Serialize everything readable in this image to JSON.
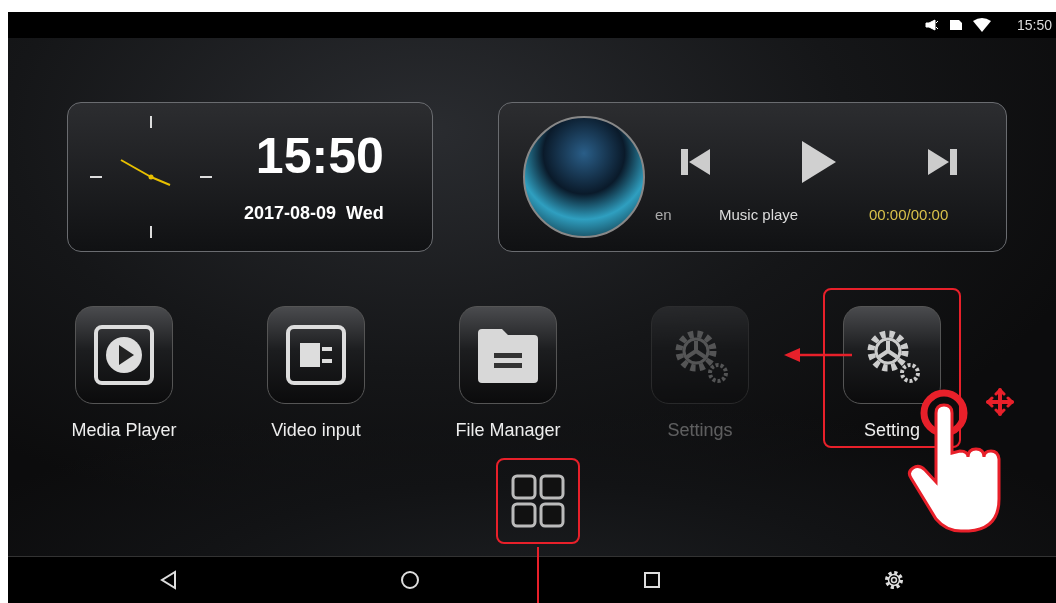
{
  "status_bar": {
    "time": "15:50"
  },
  "clock_widget": {
    "time": "15:50",
    "date": "2017-08-09",
    "weekday": "Wed"
  },
  "music_widget": {
    "track_text": "en",
    "source_label": "Music playe",
    "progress": "00:00/00:00"
  },
  "apps": [
    {
      "label": "Media Player",
      "kind": "media",
      "ghost": false,
      "highlighted": false
    },
    {
      "label": "Video input",
      "kind": "video",
      "ghost": false,
      "highlighted": false
    },
    {
      "label": "File Manager",
      "kind": "files",
      "ghost": false,
      "highlighted": false
    },
    {
      "label": "Settings",
      "kind": "settings",
      "ghost": true,
      "highlighted": false
    },
    {
      "label": "Setting",
      "kind": "settings",
      "ghost": false,
      "highlighted": true
    }
  ],
  "app_drawer": {
    "highlighted": true
  }
}
